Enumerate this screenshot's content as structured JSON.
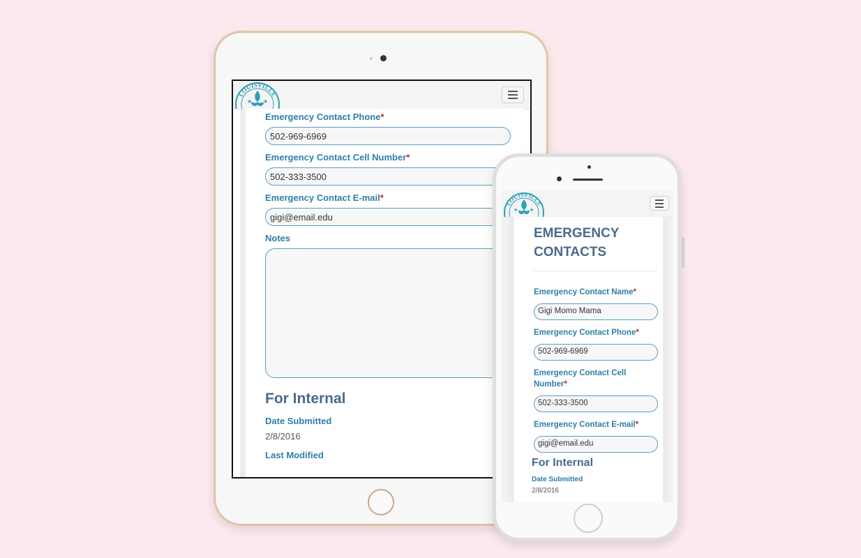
{
  "colors": {
    "background": "#fbe9ee",
    "label": "#2f7fa8",
    "required": "#c0282d",
    "heading": "#4a6a8a",
    "input_border": "#5c9cc0",
    "tablet_frame": "#e2c8a8",
    "seal": "#2d9fb6"
  },
  "logo": {
    "text": "LOUISVILLE",
    "icon": "fleur-de-lis-seal-icon"
  },
  "menu": {
    "icon": "hamburger-menu-icon"
  },
  "tablet": {
    "fields": [
      {
        "label": "Emergency Contact Phone",
        "required": "*",
        "value": "502-969-6969"
      },
      {
        "label": "Emergency Contact Cell Number",
        "required": "*",
        "value": "502-333-3500"
      },
      {
        "label": "Emergency Contact E-mail",
        "required": "*",
        "value": "gigi@email.edu"
      }
    ],
    "notes_label": "Notes",
    "internal": {
      "heading": "For Internal",
      "date_submitted_label": "Date Submitted",
      "date_submitted_value": "2/8/2016",
      "last_modified_label": "Last Modified"
    }
  },
  "phone": {
    "title_line1": "EMERGENCY",
    "title_line2": "CONTACTS",
    "fields": [
      {
        "label": "Emergency Contact Name",
        "required": "*",
        "value": "Gigi Momo Mama"
      },
      {
        "label": "Emergency Contact Phone",
        "required": "*",
        "value": "502-969-6969"
      },
      {
        "label": "Emergency Contact Cell Number",
        "required": "*",
        "value": "502-333-3500"
      },
      {
        "label": "Emergency Contact E-mail",
        "required": "*",
        "value": "gigi@email.edu"
      }
    ],
    "internal": {
      "heading": "For Internal",
      "date_submitted_label": "Date Submitted",
      "date_submitted_value": "2/8/2016"
    }
  }
}
